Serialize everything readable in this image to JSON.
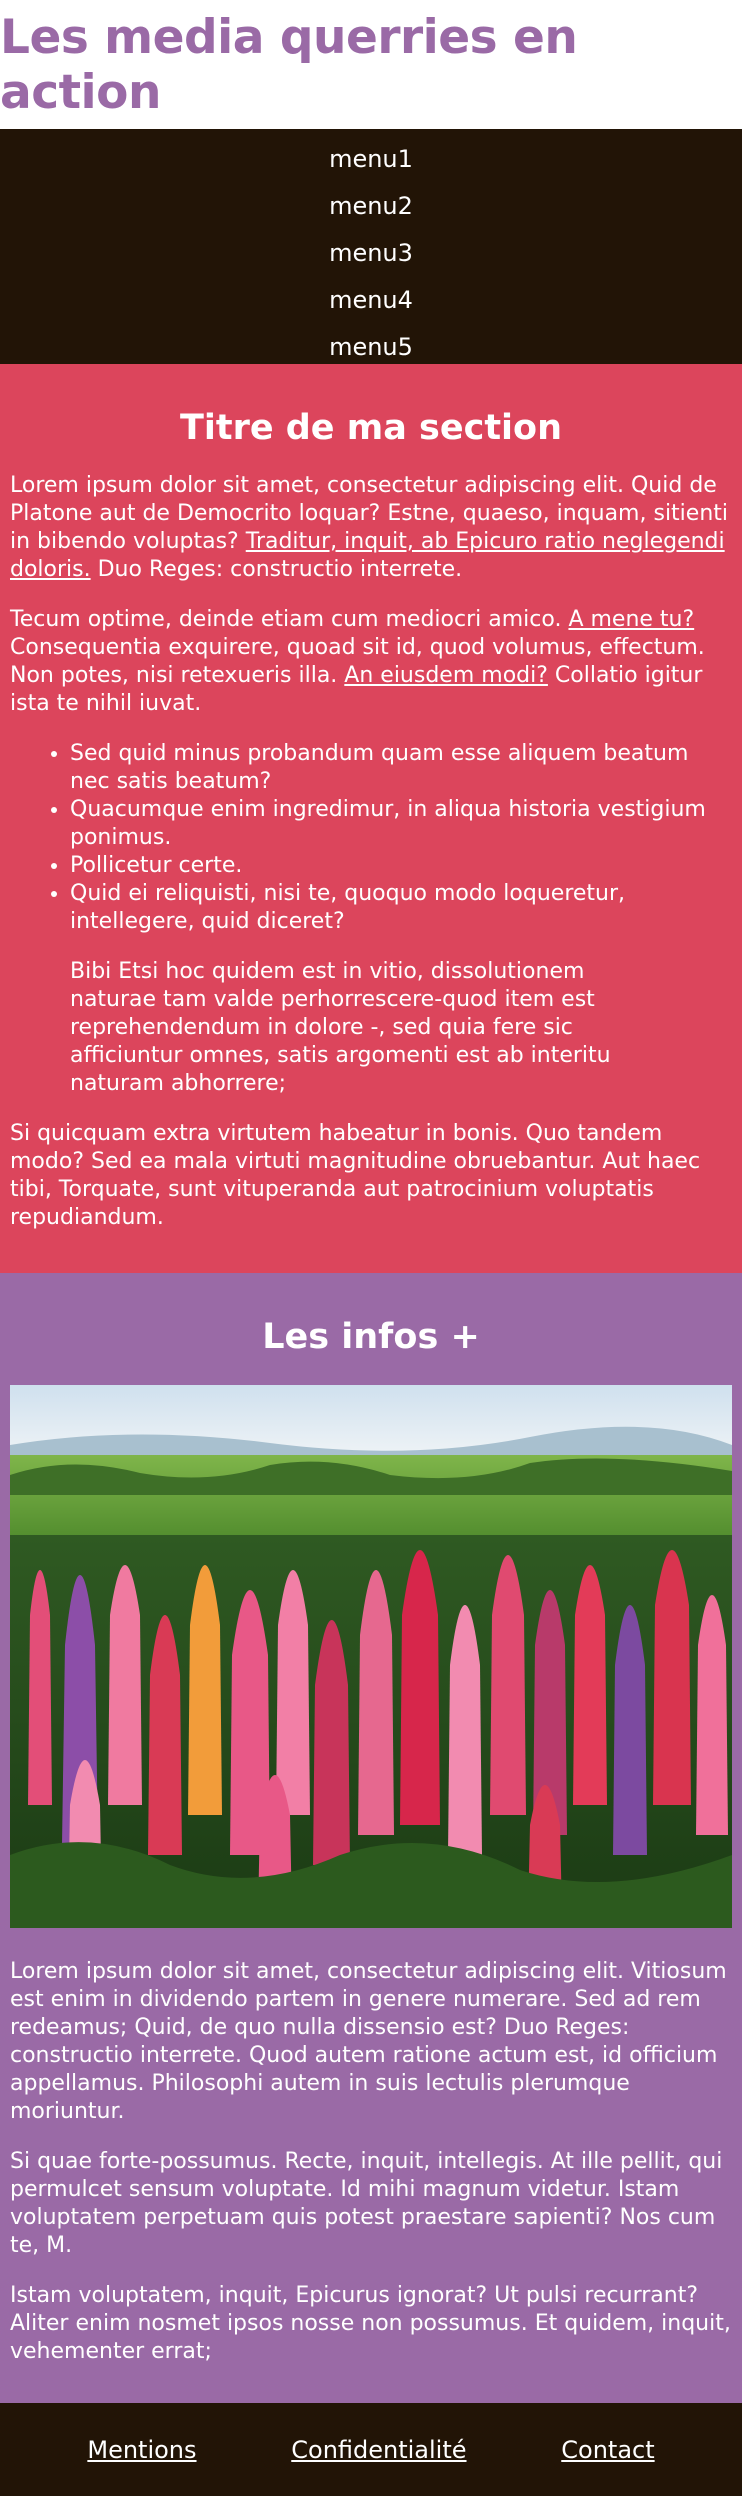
{
  "header": {
    "title": "Les media querries en action"
  },
  "nav": {
    "items": [
      "menu1",
      "menu2",
      "menu3",
      "menu4",
      "menu5"
    ]
  },
  "section1": {
    "title": "Titre de ma section",
    "p1_text": "Lorem ipsum dolor sit amet, consectetur adipiscing elit. Quid de Platone aut de Democrito loquar? Estne, quaeso, inquam, sitienti in bibendo voluptas? ",
    "p1_link": "Traditur, inquit, ab Epicuro ratio neglegendi doloris.",
    "p1_end": " Duo Reges: constructio interrete.",
    "p2_text": "Tecum optime, deinde etiam cum mediocri amico. ",
    "p2_link1": "A mene tu?",
    "p2_mid": " Consequentia exquirere, quoad sit id, quod volumus, effectum. Non potes, nisi retexueris illa. ",
    "p2_link2": "An eiusdem modi?",
    "p2_end": " Collatio igitur ista te nihil iuvat.",
    "list": [
      "Sed quid minus probandum quam esse aliquem beatum nec satis beatum?",
      "Quacumque enim ingredimur, in aliqua historia vestigium ponimus.",
      "Pollicetur certe.",
      "Quid ei reliquisti, nisi te, quoquo modo loqueretur, intellegere, quid diceret?"
    ],
    "quote": "Bibi Etsi hoc quidem est in vitio, dissolutionem naturae tam valde perhorrescere-quod item est reprehendendum in dolore -, sed quia fere sic afficiuntur omnes, satis argomenti est ab interitu naturam abhorrere;",
    "p3": "Si quicquam extra virtutem habeatur in bonis. Quo tandem modo? Sed ea mala virtuti magnitudine obruebantur. Aut haec tibi, Torquate, sunt vituperanda aut patrocinium voluptatis repudiandum."
  },
  "section2": {
    "title": "Les infos +",
    "p1": "Lorem ipsum dolor sit amet, consectetur adipiscing elit. Vitiosum est enim in dividendo partem in genere numerare. Sed ad rem redeamus; Quid, de quo nulla dissensio est? Duo Reges: constructio interrete. Quod autem ratione actum est, id officium appellamus. Philosophi autem in suis lectulis plerumque moriuntur.",
    "p2": "Si quae forte-possumus. Recte, inquit, intellegis. At ille pellit, qui permulcet sensum voluptate. Id mihi magnum videtur. Istam voluptatem perpetuam quis potest praestare sapienti? Nos cum te, M.",
    "p3": "Istam voluptatem, inquit, Epicurus ignorat? Ut pulsi recurrant? Aliter enim nosmet ipsos nosse non possumus. Et quidem, inquit, vehementer errat;"
  },
  "footer": {
    "links": [
      "Mentions",
      "Confidentialité",
      "Contact"
    ]
  },
  "colors": {
    "brand_purple": "#9a6aa6",
    "dark_brown": "#221406",
    "section_red": "#dc455c"
  }
}
